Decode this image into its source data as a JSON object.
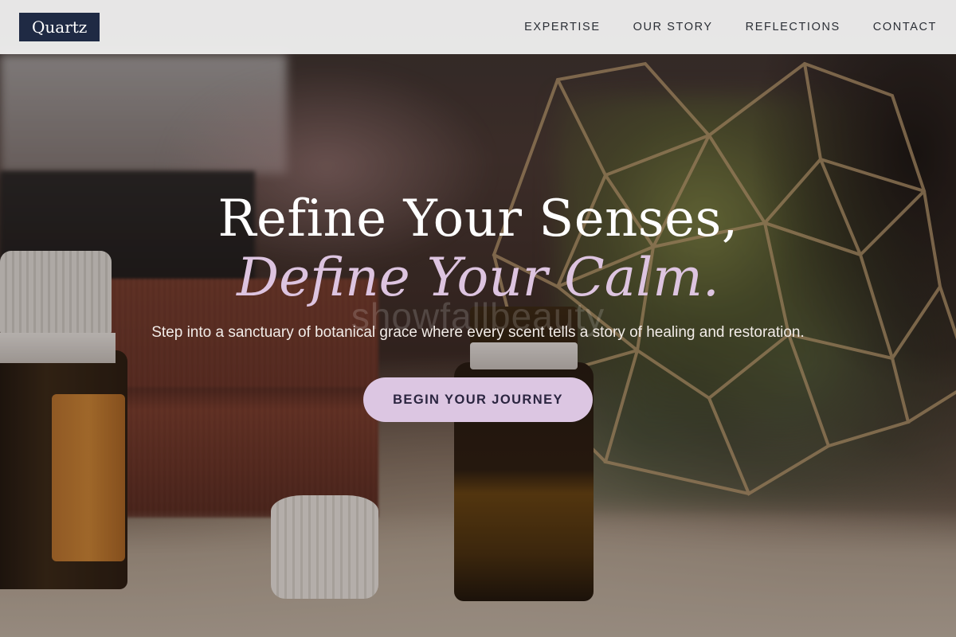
{
  "brand": {
    "logo_text": "Quartz"
  },
  "nav": {
    "items": [
      {
        "label": "EXPERTISE"
      },
      {
        "label": "OUR STORY"
      },
      {
        "label": "REFLECTIONS"
      },
      {
        "label": "CONTACT"
      }
    ]
  },
  "hero": {
    "headline_line1": "Refine Your Senses,",
    "headline_line2": "Define Your Calm.",
    "watermark": "showfallbeauty",
    "subtitle": "Step into a sanctuary of botanical grace where every scent tells a story of healing and restoration.",
    "cta_label": "BEGIN YOUR JOURNEY"
  },
  "colors": {
    "logo_background": "#1f2a44",
    "headline_accent": "#ddc4e0",
    "cta_background": "#dcc6e2",
    "nav_background": "#f5f5f5"
  }
}
